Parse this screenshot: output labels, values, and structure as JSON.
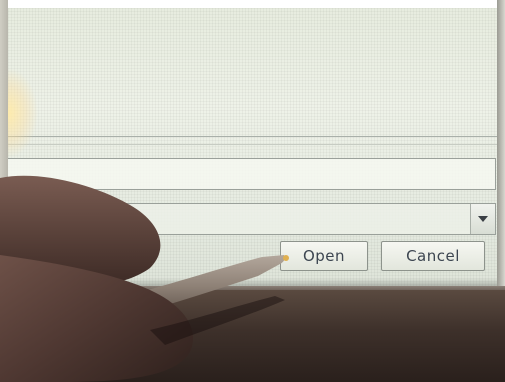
{
  "dialog": {
    "open_label": "Open",
    "cancel_label": "Cancel"
  },
  "icons": {
    "dropdown": "chevron-down-icon"
  }
}
